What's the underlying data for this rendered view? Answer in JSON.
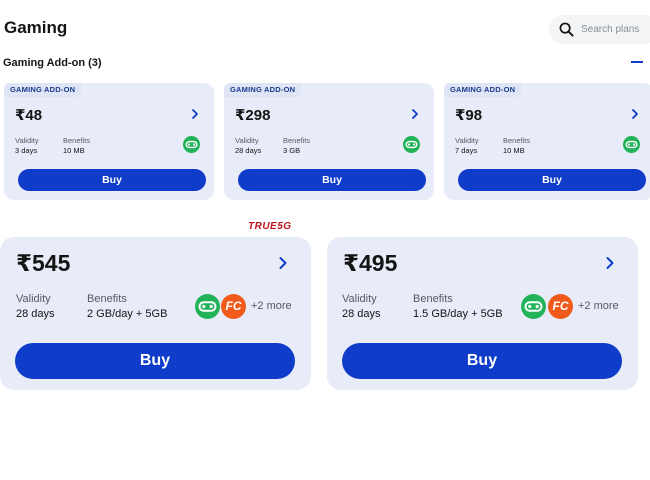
{
  "header": {
    "title": "Gaming",
    "search_placeholder": "Search plans"
  },
  "section": {
    "title": "Gaming Add-on (3)"
  },
  "addons": [
    {
      "tag": "GAMING ADD-ON",
      "price": "₹48",
      "validity_label": "Validity",
      "validity": "3 days",
      "benefits_label": "Benefits",
      "benefits": "10 MB",
      "buy_label": "Buy"
    },
    {
      "tag": "GAMING ADD-ON",
      "price": "₹298",
      "validity_label": "Validity",
      "validity": "28 days",
      "benefits_label": "Benefits",
      "benefits": "3 GB",
      "buy_label": "Buy"
    },
    {
      "tag": "GAMING ADD-ON",
      "price": "₹98",
      "validity_label": "Validity",
      "validity": "7 days",
      "benefits_label": "Benefits",
      "benefits": "10 MB",
      "buy_label": "Buy"
    }
  ],
  "true5g_label": "TRUE5G",
  "plans": [
    {
      "price": "₹545",
      "validity_label": "Validity",
      "validity": "28 days",
      "benefits_label": "Benefits",
      "benefits": "2 GB/day + 5GB",
      "more": "+2 more",
      "fc_label": "FC",
      "buy_label": "Buy"
    },
    {
      "price": "₹495",
      "validity_label": "Validity",
      "validity": "28 days",
      "benefits_label": "Benefits",
      "benefits": "1.5 GB/day + 5GB",
      "more": "+2 more",
      "fc_label": "FC",
      "buy_label": "Buy"
    }
  ],
  "colors": {
    "accent": "#0f3cc9",
    "card_bg": "#e8ecf8",
    "gaming_icon": "#22b35a",
    "fc_icon": "#f05a1a",
    "true5g": "#c1121f"
  },
  "icons": {
    "search": "search-icon",
    "collapse": "minus-icon",
    "chevron": "chevron-right-icon",
    "gaming": "gamepad-icon",
    "fc": "fancode-icon"
  }
}
